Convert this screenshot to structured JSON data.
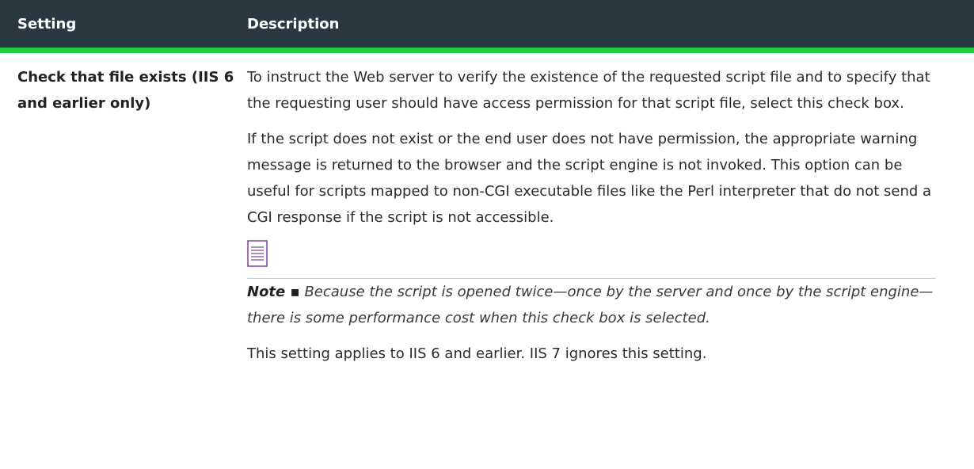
{
  "header": {
    "col_setting": "Setting",
    "col_description": "Description"
  },
  "row": {
    "setting": "Check that file exists (IIS 6 and earlier only)",
    "desc_p1": "To instruct the Web server to verify the existence of the requested script file and to specify that the requesting user should have access permission for that script file, select this check box.",
    "desc_p2": "If the script does not exist or the end user does not have permission, the appropriate warning message is returned to the browser and the script engine is not invoked. This option can be useful for scripts mapped to non-CGI executable files like the Perl interpreter that do not send a CGI response if the script is not accessible.",
    "note_label": "Note ▪",
    "note_text": " Because the script is opened twice—once by the server and once by the script engine—there is some performance cost when this check box is selected.",
    "desc_p3": "This setting applies to IIS 6 and earlier. IIS 7 ignores this setting."
  },
  "icons": {
    "note": "note-document-icon"
  },
  "colors": {
    "header_bg": "#2a3841",
    "header_accent": "#22cc44",
    "note_icon": "#7b3fa0"
  }
}
